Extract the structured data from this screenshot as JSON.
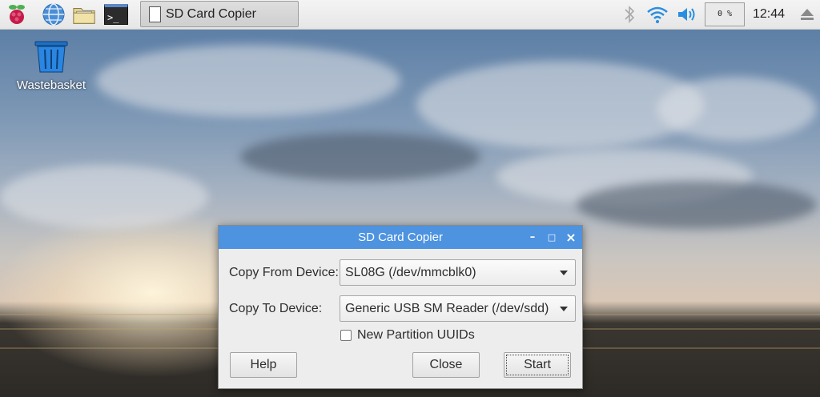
{
  "taskbar": {
    "launchers": [
      "raspberry-menu-icon",
      "web-browser-icon",
      "file-manager-icon",
      "terminal-icon"
    ],
    "terminal_glyph": ">_",
    "task_title": "SD Card Copier",
    "tray": [
      "bluetooth-icon",
      "wifi-icon",
      "volume-icon"
    ],
    "cpu_usage": "0 %",
    "clock": "12:44",
    "eject_icon": "eject-icon"
  },
  "desktop": {
    "icons": [
      {
        "label": "Wastebasket",
        "icon": "wastebasket-icon"
      }
    ]
  },
  "dialog": {
    "title": "SD Card Copier",
    "window_controls": {
      "minimize": "–",
      "maximize": "□",
      "close": "×"
    },
    "copy_from_label": "Copy From Device:",
    "copy_from_value": "SL08G  (/dev/mmcblk0)",
    "copy_to_label": "Copy To Device:",
    "copy_to_value": "Generic USB  SM Reader  (/dev/sdd)",
    "new_uuids_label": "New Partition UUIDs",
    "new_uuids_checked": false,
    "help_label": "Help",
    "close_label": "Close",
    "start_label": "Start"
  },
  "colors": {
    "titlebar": "#4d93e0",
    "raspberry": "#c51a4a",
    "tray_blue": "#2a8ee0"
  }
}
